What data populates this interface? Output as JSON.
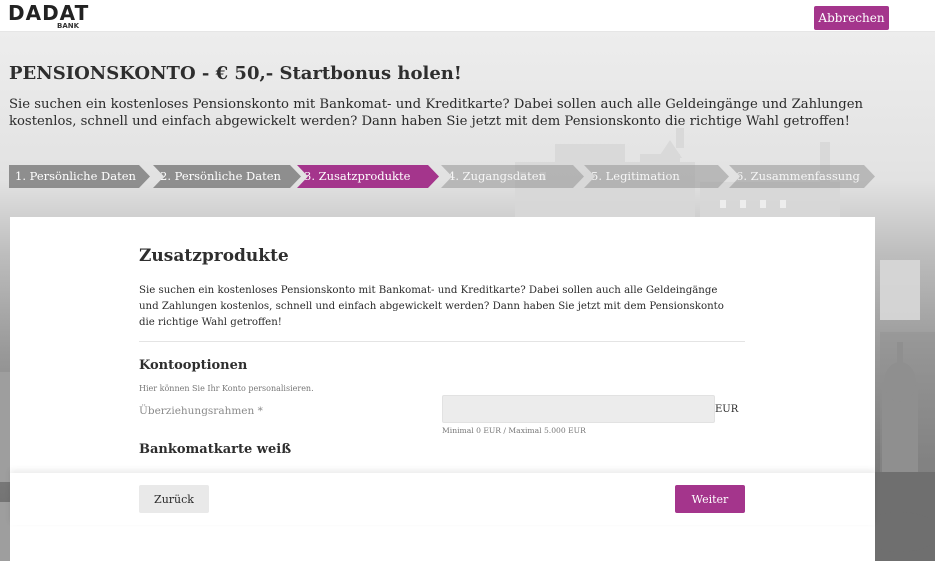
{
  "header": {
    "logo_text": "DADAT",
    "logo_sub": "BANK",
    "cancel_label": "Abbrechen"
  },
  "hero": {
    "headline": "PENSIONSKONTO - € 50,- Startbonus holen!",
    "intro": "Sie suchen ein kostenloses Pensionskonto mit Bankomat- und Kreditkarte? Dabei sollen auch alle Geldeingänge und Zahlungen kostenlos, schnell und einfach abgewickelt werden? Dann haben Sie jetzt mit dem Pensionskonto die richtige Wahl getroffen!"
  },
  "steps": [
    {
      "label": "1. Persönliche Daten",
      "state": "done"
    },
    {
      "label": "2. Persönliche Daten",
      "state": "done"
    },
    {
      "label": "3. Zusatzprodukte",
      "state": "active"
    },
    {
      "label": "4. Zugangsdaten",
      "state": "upcoming"
    },
    {
      "label": "5. Legitimation",
      "state": "upcoming"
    },
    {
      "label": "6. Zusammenfassung",
      "state": "upcoming"
    }
  ],
  "form": {
    "title": "Zusatzprodukte",
    "description": "Sie suchen ein kostenloses Pensionskonto mit Bankomat- und Kreditkarte? Dabei sollen auch alle Geldeingänge und Zahlungen kostenlos, schnell und einfach abgewickelt werden? Dann haben Sie jetzt mit dem Pensionskonto die richtige Wahl getroffen!",
    "section_options": "Kontooptionen",
    "options_hint": "Hier können Sie Ihr Konto personalisieren.",
    "overdraft_label": "Überziehungsrahmen *",
    "overdraft_value": "",
    "overdraft_unit": "EUR",
    "overdraft_note": "Minimal 0 EUR / Maximal 5.000 EUR",
    "section_card": "Bankomatkarte weiß"
  },
  "footer": {
    "back_label": "Zurück",
    "next_label": "Weiter"
  },
  "colors": {
    "accent": "#a4358c",
    "step_inactive": "#6e6e6e"
  }
}
